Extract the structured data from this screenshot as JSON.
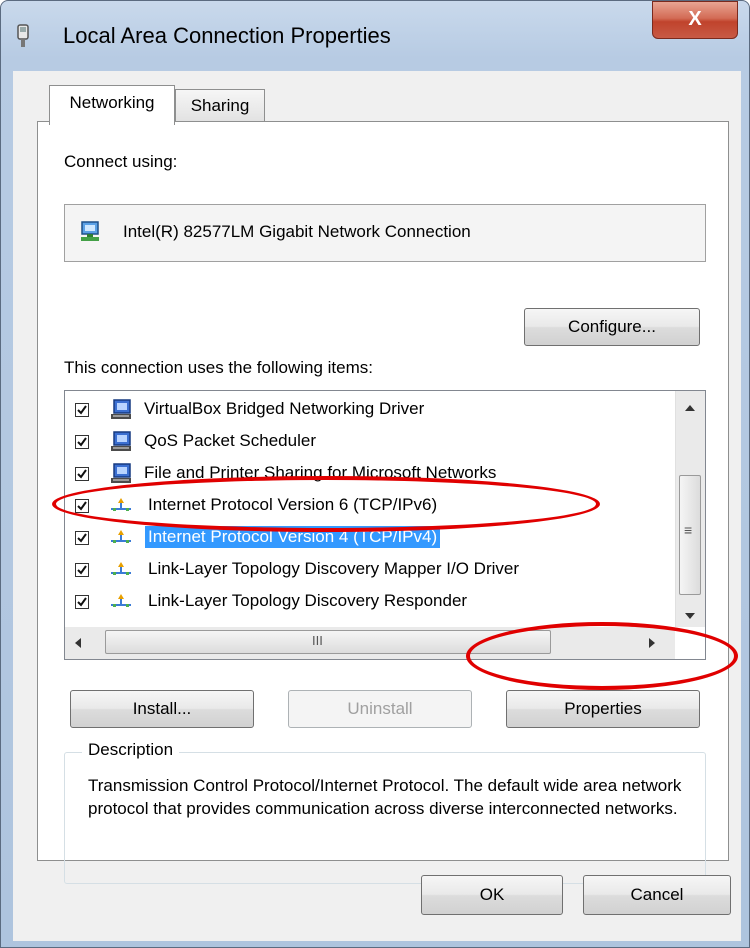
{
  "window": {
    "title": "Local Area Connection Properties",
    "close_label": "X"
  },
  "tabs": [
    {
      "label": "Networking",
      "active": true
    },
    {
      "label": "Sharing",
      "active": false
    }
  ],
  "connect_using": {
    "label": "Connect using:",
    "adapter": "Intel(R) 82577LM Gigabit Network Connection",
    "configure_label": "Configure..."
  },
  "items": {
    "label": "This connection uses the following items:",
    "list": [
      {
        "label": "VirtualBox Bridged Networking Driver",
        "checked": true,
        "icon": "network-client-icon",
        "selected": false
      },
      {
        "label": "QoS Packet Scheduler",
        "checked": true,
        "icon": "network-client-icon",
        "selected": false
      },
      {
        "label": "File and Printer Sharing for Microsoft Networks",
        "checked": true,
        "icon": "network-client-icon",
        "selected": false
      },
      {
        "label": "Internet Protocol Version 6 (TCP/IPv6)",
        "checked": true,
        "icon": "protocol-icon",
        "selected": false
      },
      {
        "label": "Internet Protocol Version 4 (TCP/IPv4)",
        "checked": true,
        "icon": "protocol-icon",
        "selected": true
      },
      {
        "label": "Link-Layer Topology Discovery Mapper I/O Driver",
        "checked": true,
        "icon": "protocol-icon",
        "selected": false
      },
      {
        "label": "Link-Layer Topology Discovery Responder",
        "checked": true,
        "icon": "protocol-icon",
        "selected": false
      }
    ],
    "hscroll_grip": "III",
    "vscroll_grip": "≡"
  },
  "actions": {
    "install_label": "Install...",
    "uninstall_label": "Uninstall",
    "properties_label": "Properties"
  },
  "description": {
    "legend": "Description",
    "text": "Transmission Control Protocol/Internet Protocol. The default wide area network protocol that provides communication across diverse interconnected networks."
  },
  "footer": {
    "ok_label": "OK",
    "cancel_label": "Cancel"
  },
  "colors": {
    "selection": "#3399ff",
    "annotation": "#e00000",
    "title_bar": "#b7cbe3"
  }
}
